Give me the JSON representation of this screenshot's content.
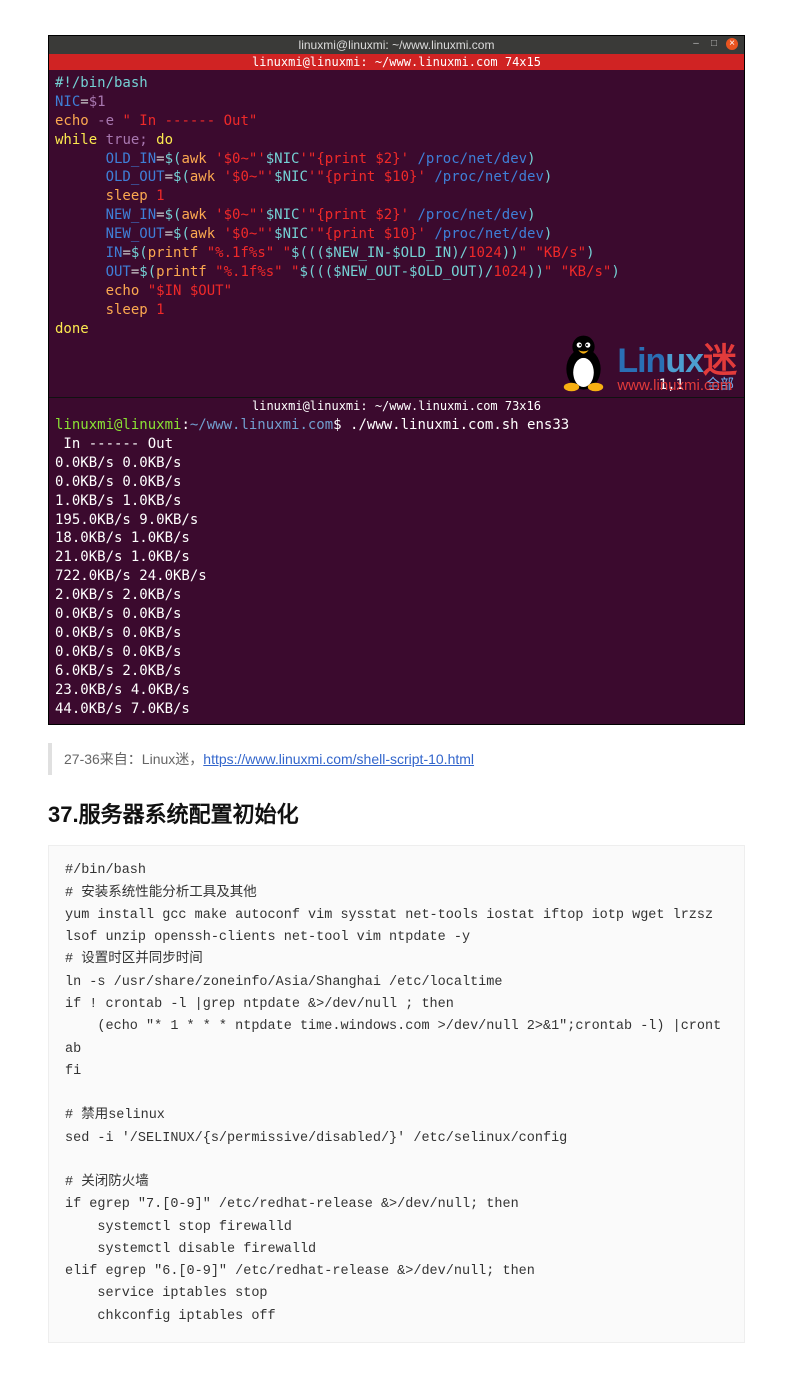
{
  "terminal": {
    "window_title": "linuxmi@linuxmi: ~/www.linuxmi.com",
    "tab_upper": "linuxmi@linuxmi: ~/www.linuxmi.com 74x15",
    "tab_lower": "linuxmi@linuxmi: ~/www.linuxmi.com 73x16",
    "cursor_pos": "1,1",
    "all_label": "全部",
    "script": {
      "l1_shebang": "#!/bin/bash",
      "l2_a": "NIC",
      "l2_b": "=",
      "l2_c": "$1",
      "l3_a": "echo",
      "l3_b": " -e ",
      "l3_c": "\" In ------ Out\"",
      "l4_a": "while",
      "l4_b": " true; ",
      "l4_c": "do",
      "l5_a": "      OLD_IN",
      "l5_b": "=",
      "l5_c": "$(",
      "l5_d": "awk ",
      "l5_e": "'$0~\"'",
      "l5_f": "$NIC",
      "l5_g": "'\"{print $2}'",
      "l5_h": " /proc/net/dev",
      "l5_i": ")",
      "l6_a": "      OLD_OUT",
      "l6_b": "=",
      "l6_c": "$(",
      "l6_d": "awk ",
      "l6_e": "'$0~\"'",
      "l6_f": "$NIC",
      "l6_g": "'\"{print $10}'",
      "l6_h": " /proc/net/dev",
      "l6_i": ")",
      "l7_a": "      sleep",
      "l7_b": " 1",
      "l8_a": "      NEW_IN",
      "l8_b": "=",
      "l8_c": "$(",
      "l8_d": "awk ",
      "l8_e": "'$0~\"'",
      "l8_f": "$NIC",
      "l8_g": "'\"{print $2}'",
      "l8_h": " /proc/net/dev",
      "l8_i": ")",
      "l9_a": "      NEW_OUT",
      "l9_b": "=",
      "l9_c": "$(",
      "l9_d": "awk ",
      "l9_e": "'$0~\"'",
      "l9_f": "$NIC",
      "l9_g": "'\"{print $10}'",
      "l9_h": " /proc/net/dev",
      "l9_i": ")",
      "l10_a": "      IN",
      "l10_b": "=",
      "l10_c": "$(",
      "l10_d": "printf ",
      "l10_e": "\"%.1f%s\" \"",
      "l10_f": "$((($NEW_IN-$OLD_IN)/",
      "l10_g": "1024",
      "l10_h": "))",
      "l10_i": "\" \"KB/s\"",
      "l10_j": ")",
      "l11_a": "      OUT",
      "l11_b": "=",
      "l11_c": "$(",
      "l11_d": "printf ",
      "l11_e": "\"%.1f%s\" \"",
      "l11_f": "$((($NEW_OUT-$OLD_OUT)/",
      "l11_g": "1024",
      "l11_h": "))",
      "l11_i": "\" \"KB/s\"",
      "l11_j": ")",
      "l12_a": "      echo",
      "l12_b": " ",
      "l12_c": "\"$IN $OUT\"",
      "l13_a": "      sleep",
      "l13_b": " 1",
      "l14": "done"
    },
    "output": {
      "prompt_user": "linuxmi@linuxmi",
      "prompt_sep": ":",
      "prompt_path": "~/www.linuxmi.com",
      "prompt_dollar": "$ ",
      "cmd": "./www.linuxmi.com.sh ens33",
      "header": " In ------ Out",
      "rows": [
        "0.0KB/s 0.0KB/s",
        "0.0KB/s 0.0KB/s",
        "1.0KB/s 1.0KB/s",
        "195.0KB/s 9.0KB/s",
        "18.0KB/s 1.0KB/s",
        "21.0KB/s 1.0KB/s",
        "722.0KB/s 24.0KB/s",
        "2.0KB/s 2.0KB/s",
        "0.0KB/s 0.0KB/s",
        "0.0KB/s 0.0KB/s",
        "0.0KB/s 0.0KB/s",
        "6.0KB/s 2.0KB/s",
        "23.0KB/s 4.0KB/s",
        "44.0KB/s 7.0KB/s"
      ]
    },
    "overlay": {
      "text": "Linux迷",
      "url": "www.linuxmi.com"
    }
  },
  "quote": {
    "prefix": "27-36来自：Linux迷，",
    "link_text": "https://www.linuxmi.com/shell-script-10.html"
  },
  "heading": "37.服务器系统配置初始化",
  "codeblock": "#/bin/bash\n# 安装系统性能分析工具及其他\nyum install gcc make autoconf vim sysstat net-tools iostat iftop iotp wget lrzsz lsof unzip openssh-clients net-tool vim ntpdate -y\n# 设置时区并同步时间\nln -s /usr/share/zoneinfo/Asia/Shanghai /etc/localtime\nif ! crontab -l |grep ntpdate &>/dev/null ; then\n    (echo \"* 1 * * * ntpdate time.windows.com >/dev/null 2>&1\";crontab -l) |crontab\nfi\n\n# 禁用selinux\nsed -i '/SELINUX/{s/permissive/disabled/}' /etc/selinux/config\n\n# 关闭防火墙\nif egrep \"7.[0-9]\" /etc/redhat-release &>/dev/null; then\n    systemctl stop firewalld\n    systemctl disable firewalld\nelif egrep \"6.[0-9]\" /etc/redhat-release &>/dev/null; then\n    service iptables stop\n    chkconfig iptables off"
}
